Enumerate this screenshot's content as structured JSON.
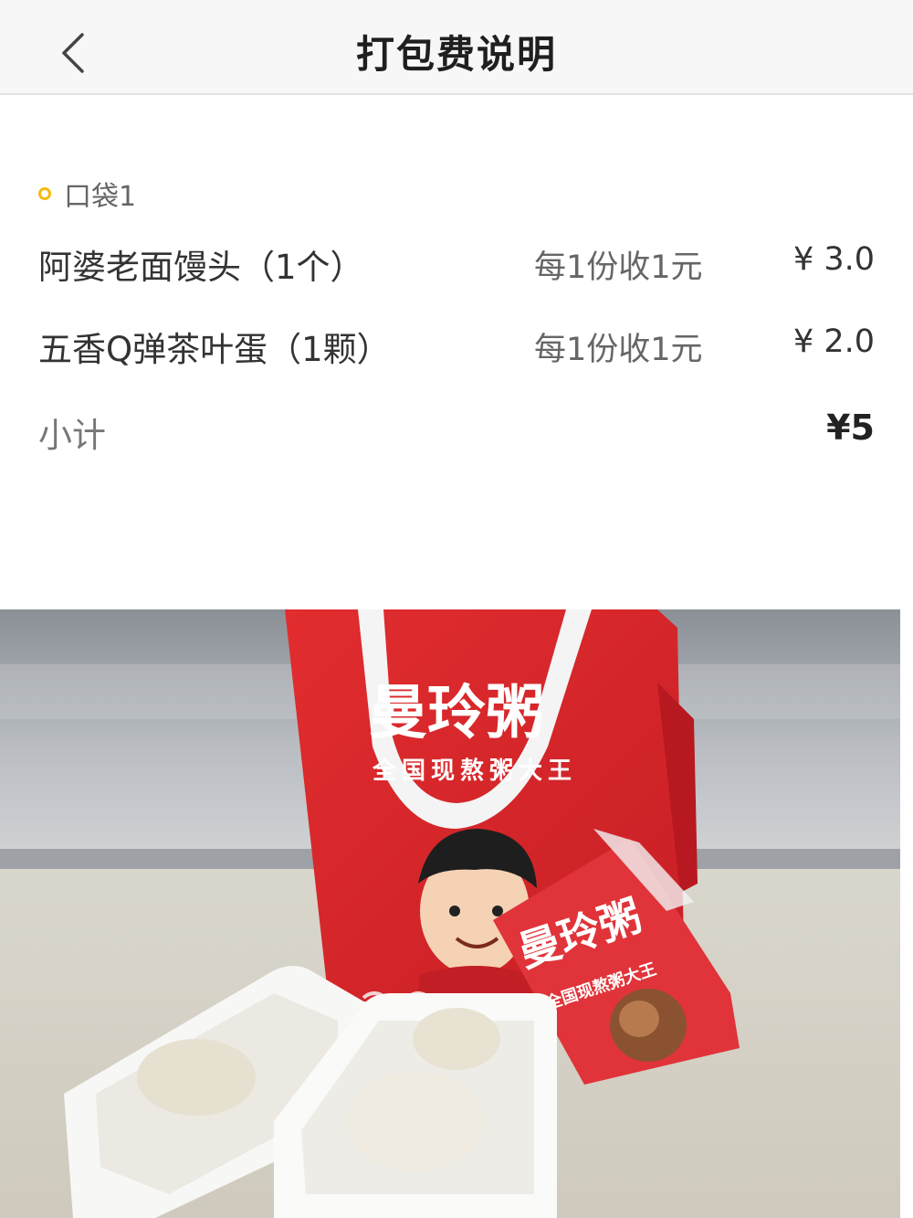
{
  "header": {
    "title": "打包费说明"
  },
  "bag": {
    "label": "口袋1",
    "items": [
      {
        "name": "阿婆老面馒头（1个）",
        "rule": "每1份收1元",
        "price": "¥ 3.0"
      },
      {
        "name": "五香Q弹茶叶蛋（1颗）",
        "rule": "每1份收1元",
        "price": "¥ 2.0"
      }
    ],
    "subtotal_label": "小计",
    "subtotal_value": "¥5"
  },
  "photo": {
    "bag_brand": "曼玲粥",
    "bag_slogan": "全国现熬粥大王",
    "packet_brand": "曼玲粥",
    "packet_slogan": "全国现熬粥大王"
  },
  "colors": {
    "accent_dot": "#f5b90f",
    "bag_red": "#d8262b"
  }
}
